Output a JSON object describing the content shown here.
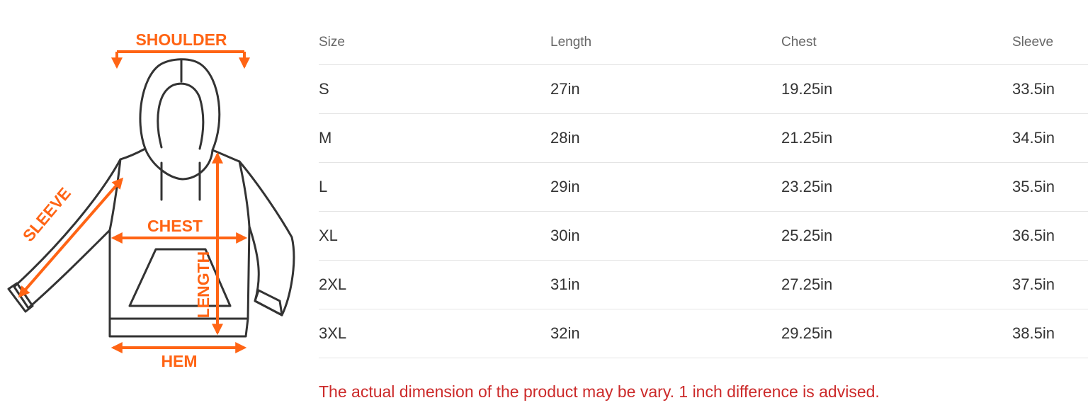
{
  "diagram": {
    "labels": {
      "shoulder": "SHOULDER",
      "sleeve": "SLEEVE",
      "chest": "CHEST",
      "length": "LENGTH",
      "hem": "HEM"
    },
    "accent_color": "#ff6414",
    "outline_color": "#333333"
  },
  "table": {
    "headers": [
      "Size",
      "Length",
      "Chest",
      "Sleeve"
    ],
    "rows": [
      [
        "S",
        "27in",
        "19.25in",
        "33.5in"
      ],
      [
        "M",
        "28in",
        "21.25in",
        "34.5in"
      ],
      [
        "L",
        "29in",
        "23.25in",
        "35.5in"
      ],
      [
        "XL",
        "30in",
        "25.25in",
        "36.5in"
      ],
      [
        "2XL",
        "31in",
        "27.25in",
        "37.5in"
      ],
      [
        "3XL",
        "32in",
        "29.25in",
        "38.5in"
      ]
    ]
  },
  "note": "The actual dimension of the product may be vary. 1 inch difference is advised.",
  "colors": {
    "note": "#cc2a2a",
    "header_text": "#666666",
    "cell_text": "#333333",
    "divider": "#e4e4e4"
  }
}
